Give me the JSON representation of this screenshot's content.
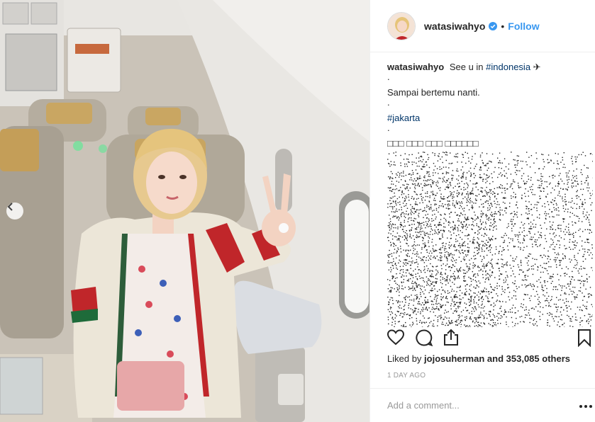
{
  "post": {
    "username": "watasiwahyo",
    "follow_label": "Follow",
    "separator": "•",
    "caption_text": "See u in",
    "caption_hashtag1": "#indonesia",
    "caption_emoji": "✈",
    "caption_dot": ".",
    "caption_line2": "Sampai bertemu nanti.",
    "caption_hashtag2": "#jakarta",
    "caption_korean": "□□□ □□□ □□□ □□□□□□",
    "likes_prefix": "Liked by",
    "likes_user": "jojosuherman",
    "likes_suffix": "and 353,085 others",
    "timestamp": "1 DAY AGO",
    "comment_placeholder": "Add a comment..."
  },
  "colors": {
    "link": "#3897f0",
    "hashtag": "#003569",
    "verified": "#3897f0",
    "muted": "#999999"
  },
  "icons": [
    "chevron-left-icon",
    "verified-badge-icon",
    "heart-icon",
    "comment-icon",
    "share-icon",
    "bookmark-icon",
    "more-options-icon"
  ]
}
